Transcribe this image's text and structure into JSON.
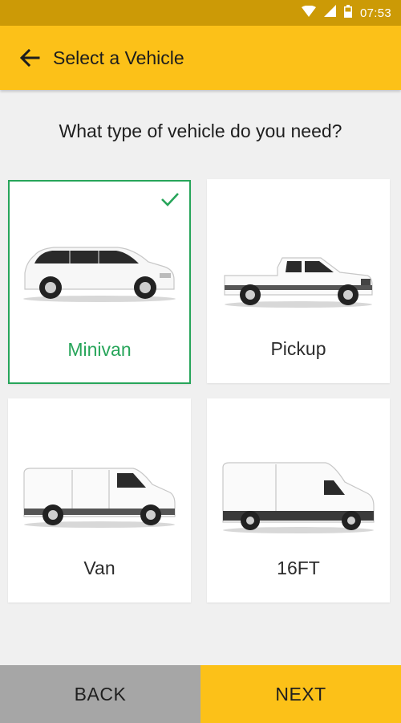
{
  "status_bar": {
    "time": "07:53"
  },
  "header": {
    "title": "Select a Vehicle"
  },
  "question": "What type of vehicle do you need?",
  "vehicles": [
    {
      "label": "Minivan",
      "icon": "minivan-image",
      "selected": true
    },
    {
      "label": "Pickup",
      "icon": "pickup-truck-image",
      "selected": false
    },
    {
      "label": "Van",
      "icon": "cargo-van-image",
      "selected": false
    },
    {
      "label": "16FT",
      "icon": "box-truck-image",
      "selected": false
    }
  ],
  "footer": {
    "back_label": "BACK",
    "next_label": "NEXT"
  },
  "colors": {
    "accent": "#fcc118",
    "status_bar": "#cc9a06",
    "selected": "#27a55a",
    "back_button": "#a6a6a6"
  }
}
